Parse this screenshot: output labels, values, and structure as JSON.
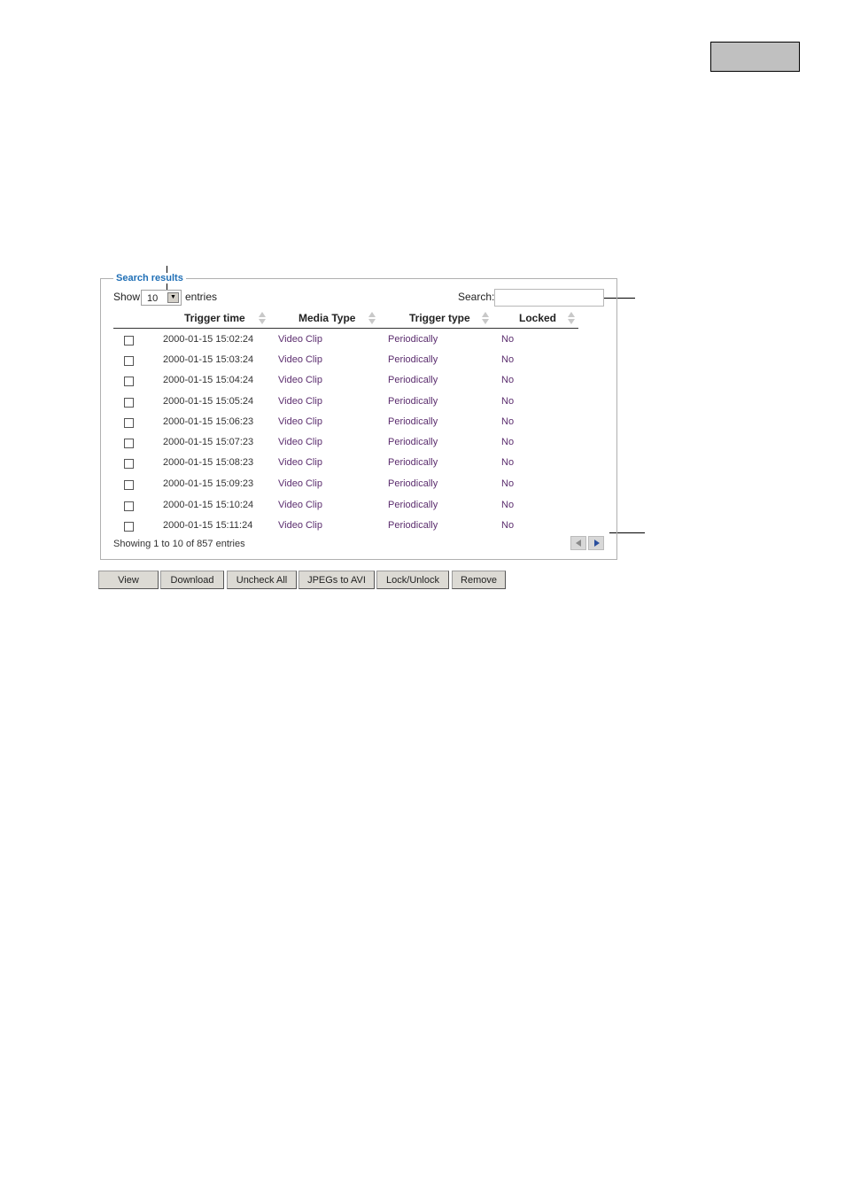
{
  "fieldset": {
    "legend": "Search results"
  },
  "controls": {
    "show_label": "Show",
    "page_size": "10",
    "entries_label": "entries",
    "search_label": "Search:",
    "search_value": ""
  },
  "table": {
    "headers": [
      "Trigger time",
      "Media Type",
      "Trigger type",
      "Locked"
    ],
    "rows": [
      {
        "time": "2000-01-15 15:02:24",
        "media": "Video Clip",
        "trigger": "Periodically",
        "locked": "No"
      },
      {
        "time": "2000-01-15 15:03:24",
        "media": "Video Clip",
        "trigger": "Periodically",
        "locked": "No"
      },
      {
        "time": "2000-01-15 15:04:24",
        "media": "Video Clip",
        "trigger": "Periodically",
        "locked": "No"
      },
      {
        "time": "2000-01-15 15:05:24",
        "media": "Video Clip",
        "trigger": "Periodically",
        "locked": "No"
      },
      {
        "time": "2000-01-15 15:06:23",
        "media": "Video Clip",
        "trigger": "Periodically",
        "locked": "No"
      },
      {
        "time": "2000-01-15 15:07:23",
        "media": "Video Clip",
        "trigger": "Periodically",
        "locked": "No"
      },
      {
        "time": "2000-01-15 15:08:23",
        "media": "Video Clip",
        "trigger": "Periodically",
        "locked": "No"
      },
      {
        "time": "2000-01-15 15:09:23",
        "media": "Video Clip",
        "trigger": "Periodically",
        "locked": "No"
      },
      {
        "time": "2000-01-15 15:10:24",
        "media": "Video Clip",
        "trigger": "Periodically",
        "locked": "No"
      },
      {
        "time": "2000-01-15 15:11:24",
        "media": "Video Clip",
        "trigger": "Periodically",
        "locked": "No"
      }
    ]
  },
  "info": "Showing 1 to 10 of 857 entries",
  "buttons": {
    "view": "View",
    "download": "Download",
    "uncheck_all": "Uncheck All",
    "jpegs_to_avi": "JPEGs to AVI",
    "lock_unlock": "Lock/Unlock",
    "remove": "Remove"
  },
  "icons": {
    "select_arrow": "chevron-down-icon",
    "sort": "sort-arrows-icon",
    "prev": "previous-page-icon",
    "next": "next-page-icon"
  },
  "colors": {
    "legend": "#1f6fb6",
    "link_text": "#5b2d6e",
    "grey_box": "#c0c0c0",
    "button_face": "#dcdad4"
  }
}
